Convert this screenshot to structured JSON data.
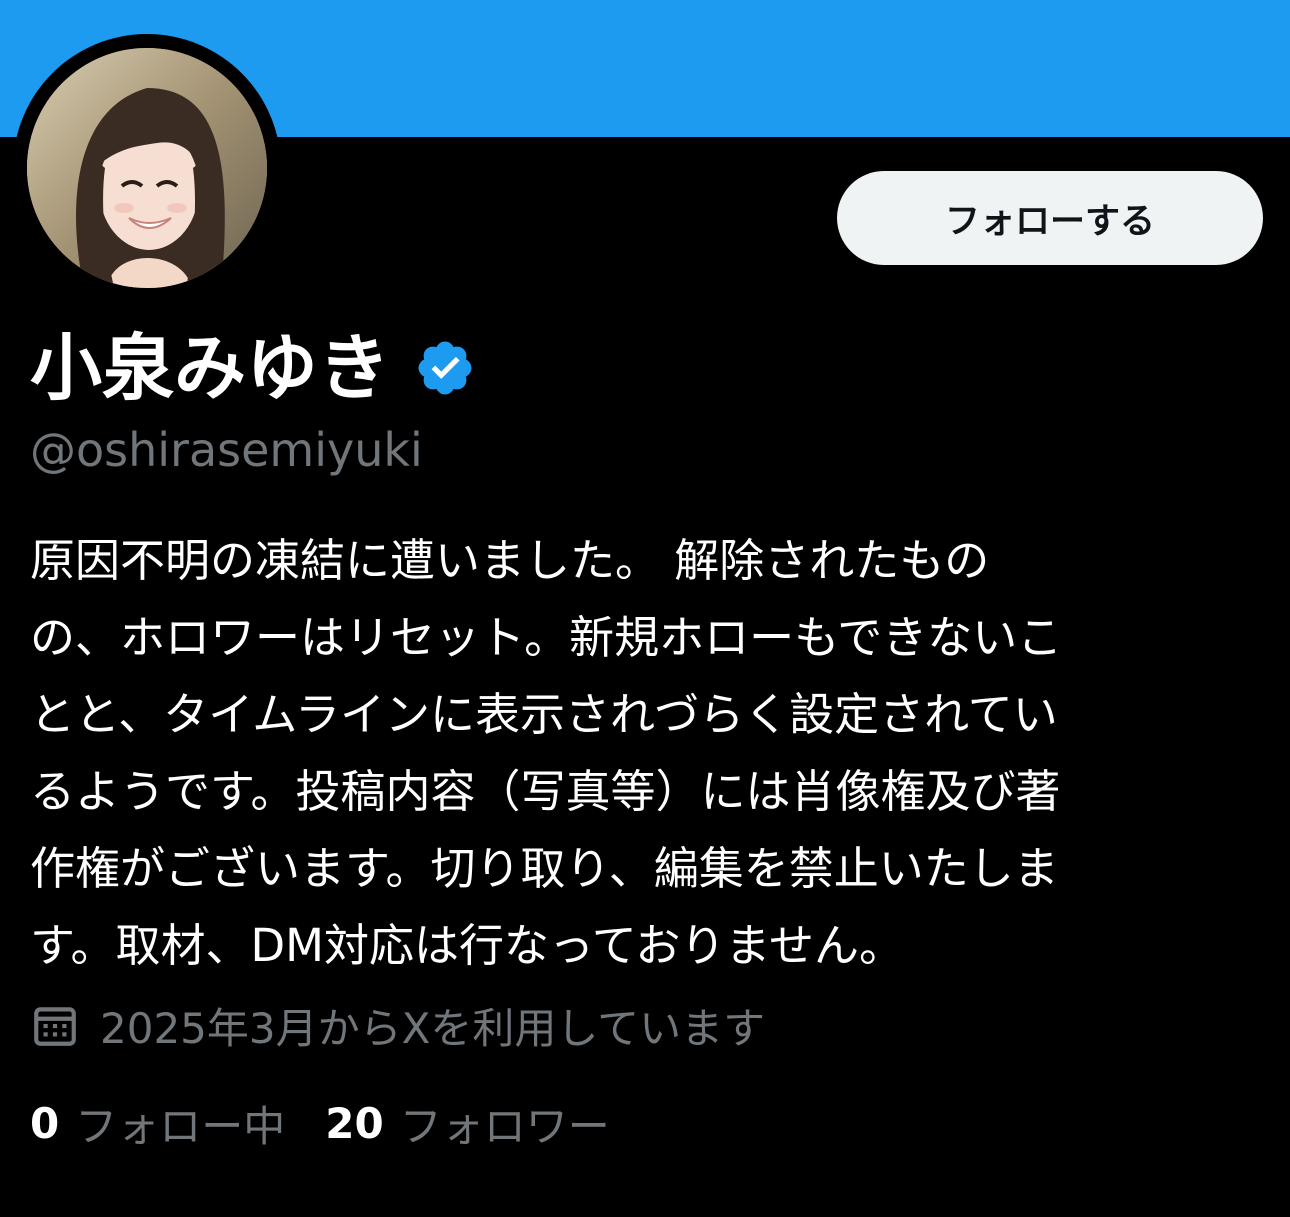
{
  "profile": {
    "display_name": "小泉みゆき",
    "handle": "@oshirasemiyuki",
    "verified": true,
    "bio_lines": [
      "原因不明の凍結に遭いました。 解除されたもの",
      "の、ホロワーはリセット。新規ホローもできないこ",
      "とと、タイムラインに表示されづらく設定されてい",
      "るようです。投稿内容（写真等）には肖像権及び著",
      "作権がございます。切り取り、編集を禁止いたしま",
      "す。取材、DM対応は行なっておりません。"
    ],
    "joined": "2025年3月からXを利用しています",
    "following_count": "0",
    "following_label": "フォロー中",
    "followers_count": "20",
    "followers_label": "フォロワー"
  },
  "actions": {
    "follow_label": "フォローする"
  },
  "icons": {
    "verified": "verified-badge-icon",
    "joined": "calendar-icon"
  },
  "colors": {
    "banner": "#1d9bf0",
    "background": "#000000",
    "verified": "#1d9bf0",
    "secondary_text": "#71767b",
    "follow_button_bg": "#eff3f4"
  }
}
